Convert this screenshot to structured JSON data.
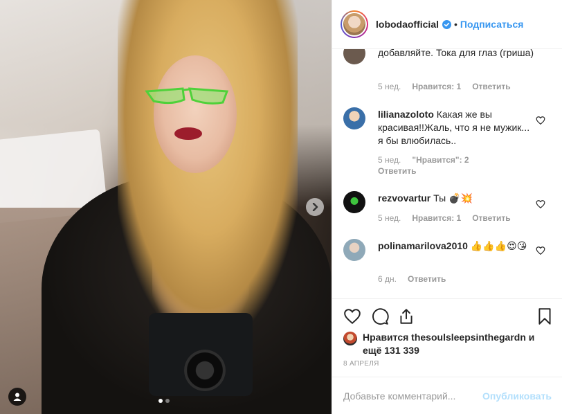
{
  "post": {
    "username": "lobodaofficial",
    "follow_label": "Подписаться",
    "separator": "•"
  },
  "comments": [
    {
      "username": "",
      "text": "добавляйте. Тока для глаз (гриша)",
      "time": "5 нед.",
      "likes": "Нравится: 1",
      "reply": "Ответить",
      "avatar_color": "#6b5a4e"
    },
    {
      "username": "lilianazoloto",
      "text": "Какая же вы красивая!!Жаль, что я не мужик... я бы влюбилась..",
      "time": "5 нед.",
      "likes": "\"Нравится\": 2",
      "reply": "Ответить",
      "avatar_color": "#3a6fa8"
    },
    {
      "username": "rezvovartur",
      "text": "Ты 💣💥",
      "time": "5 нед.",
      "likes": "Нравится: 1",
      "reply": "Ответить",
      "avatar_color": "#1a1a1a"
    },
    {
      "username": "polinamarilova2010",
      "text": "👍👍👍😍😘",
      "time": "6 дн.",
      "likes": "",
      "reply": "Ответить",
      "avatar_color": "#8fa9b8"
    }
  ],
  "actions": {
    "like_icon": "heart-icon",
    "comment_icon": "comment-icon",
    "share_icon": "share-icon",
    "save_icon": "bookmark-icon"
  },
  "likes_summary": {
    "text": "Нравится thesoulsleepsinthegardn и ещё 131 339"
  },
  "date": "8 апреля",
  "add_comment": {
    "placeholder": "Добавьте комментарий...",
    "publish_label": "Опубликовать"
  },
  "colors": {
    "accent": "#3897f0",
    "publish_disabled": "#b2dffc",
    "muted": "#999999"
  }
}
